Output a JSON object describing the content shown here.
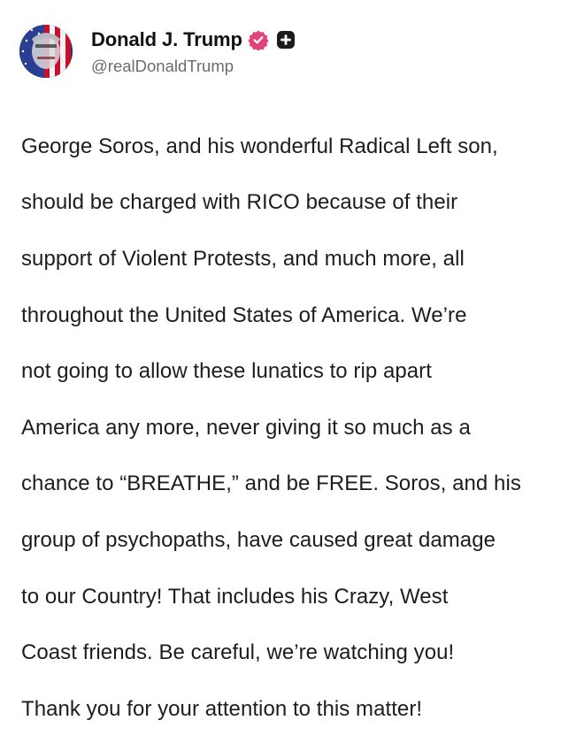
{
  "post": {
    "author": {
      "display_name": "Donald J. Trump",
      "handle": "@realDonaldTrump",
      "verified_icon": "verified-badge-icon",
      "plus_icon": "plus-badge-icon",
      "verified_color": "#e0447a",
      "plus_badge_color": "#1c1c1e"
    },
    "lines": [
      "George Soros, and his wonderful Radical Left son,",
      "should be charged with RICO because of their",
      "support of Violent Protests, and much more, all",
      "throughout the United States of America. We’re",
      "not going to allow these lunatics to rip apart",
      "America any more, never giving it so much as a",
      "chance to “BREATHE,” and be FREE. Soros, and his",
      "group of psychopaths, have caused great damage",
      "to our Country! That includes his Crazy, West",
      "Coast friends. Be careful, we’re watching you!",
      "Thank you for your attention to this matter!"
    ]
  }
}
